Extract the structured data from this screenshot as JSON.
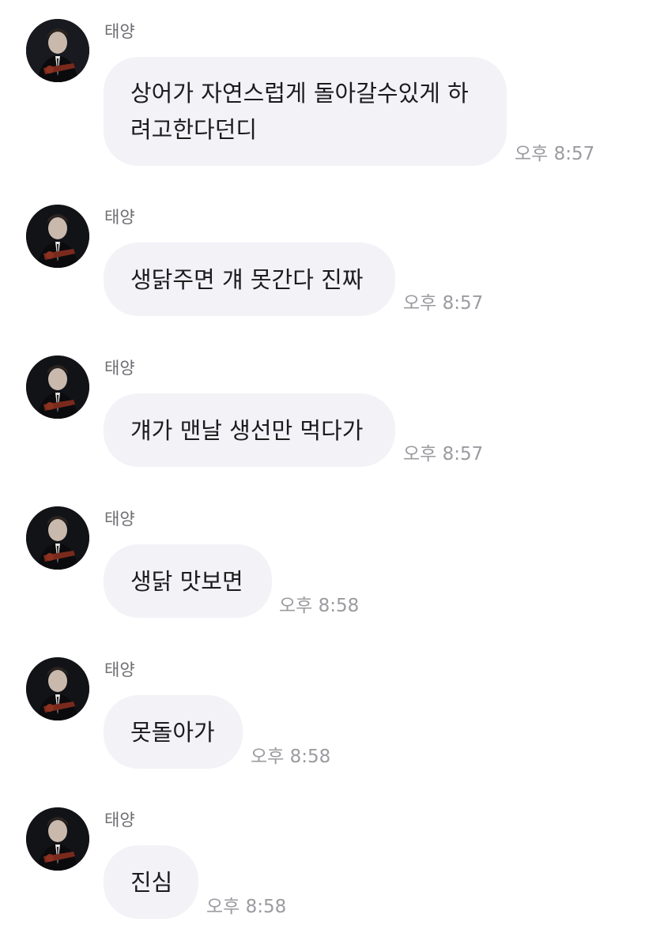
{
  "conversation": {
    "messages": [
      {
        "sender": "태양",
        "text": "상어가 자연스럽게 돌아갈수있게 하려고한다던디",
        "line1": "상어가 자연스럽게 돌아갈수있게 하",
        "line2": "려고한다던디",
        "time": "오후 8:57"
      },
      {
        "sender": "태양",
        "text": "생닭주면 걔 못간다 진짜",
        "time": "오후 8:57"
      },
      {
        "sender": "태양",
        "text": "걔가 맨날 생선만 먹다가",
        "time": "오후 8:57"
      },
      {
        "sender": "태양",
        "text": "생닭 맛보면",
        "time": "오후 8:58"
      },
      {
        "sender": "태양",
        "text": "못돌아가",
        "time": "오후 8:58"
      },
      {
        "sender": "태양",
        "text": "진심",
        "time": "오후 8:58"
      }
    ]
  },
  "colors": {
    "bubble": "#f2f2f7",
    "sender": "#6e6e73",
    "timestamp": "#9b9ba0",
    "text": "#1c1c1e"
  },
  "icons": {
    "avatar": "profile-photo"
  }
}
